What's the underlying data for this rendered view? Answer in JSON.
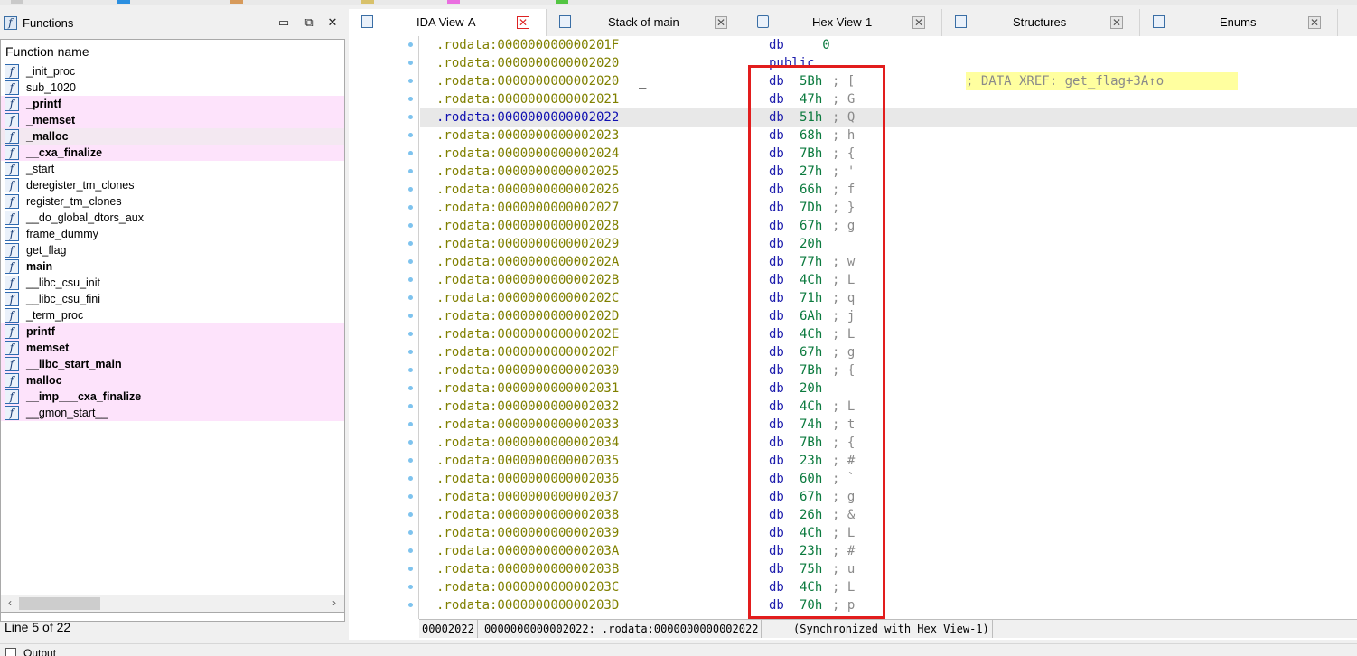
{
  "functions_panel": {
    "title": "Functions",
    "column_header": "Function name",
    "status": "Line 5 of 22",
    "items": [
      {
        "name": "_init_proc",
        "bold": false,
        "pink": false
      },
      {
        "name": "sub_1020",
        "bold": false,
        "pink": false
      },
      {
        "name": "_printf",
        "bold": true,
        "pink": true
      },
      {
        "name": "_memset",
        "bold": true,
        "pink": true
      },
      {
        "name": "_malloc",
        "bold": true,
        "pink": true,
        "selected": true
      },
      {
        "name": "__cxa_finalize",
        "bold": true,
        "pink": true
      },
      {
        "name": "_start",
        "bold": false,
        "pink": false
      },
      {
        "name": "deregister_tm_clones",
        "bold": false,
        "pink": false
      },
      {
        "name": "register_tm_clones",
        "bold": false,
        "pink": false
      },
      {
        "name": "__do_global_dtors_aux",
        "bold": false,
        "pink": false
      },
      {
        "name": "frame_dummy",
        "bold": false,
        "pink": false
      },
      {
        "name": "get_flag",
        "bold": false,
        "pink": false
      },
      {
        "name": "main",
        "bold": true,
        "pink": false
      },
      {
        "name": "__libc_csu_init",
        "bold": false,
        "pink": false
      },
      {
        "name": "__libc_csu_fini",
        "bold": false,
        "pink": false
      },
      {
        "name": "_term_proc",
        "bold": false,
        "pink": false
      },
      {
        "name": "printf",
        "bold": true,
        "pink": true
      },
      {
        "name": "memset",
        "bold": true,
        "pink": true
      },
      {
        "name": "__libc_start_main",
        "bold": true,
        "pink": true
      },
      {
        "name": "malloc",
        "bold": true,
        "pink": true
      },
      {
        "name": "__imp___cxa_finalize",
        "bold": true,
        "pink": true
      },
      {
        "name": "__gmon_start__",
        "bold": false,
        "pink": true
      }
    ]
  },
  "tabs": [
    {
      "label": "IDA View-A",
      "active": true
    },
    {
      "label": "Stack of main",
      "active": false
    },
    {
      "label": "Hex View-1",
      "active": false
    },
    {
      "label": "Structures",
      "active": false
    },
    {
      "label": "Enums",
      "active": false
    }
  ],
  "disasm": {
    "lines": [
      {
        "addr": ".rodata:000000000000201F",
        "label": "",
        "mnem": "db",
        "val": "   0",
        "cmt": ""
      },
      {
        "addr": ".rodata:0000000000002020",
        "label": "",
        "mnem": "public _",
        "val": "",
        "cmt": ""
      },
      {
        "addr": ".rodata:0000000000002020",
        "label": "_",
        "mnem": "db",
        "val": "5Bh",
        "cmt": "; [",
        "xref": "; DATA XREF: get_flag+3A↑o"
      },
      {
        "addr": ".rodata:0000000000002021",
        "label": "",
        "mnem": "db",
        "val": "47h",
        "cmt": "; G"
      },
      {
        "addr": ".rodata:0000000000002022",
        "label": "",
        "mnem": "db",
        "val": "51h",
        "cmt": "; Q",
        "selected": true
      },
      {
        "addr": ".rodata:0000000000002023",
        "label": "",
        "mnem": "db",
        "val": "68h",
        "cmt": "; h"
      },
      {
        "addr": ".rodata:0000000000002024",
        "label": "",
        "mnem": "db",
        "val": "7Bh",
        "cmt": "; {"
      },
      {
        "addr": ".rodata:0000000000002025",
        "label": "",
        "mnem": "db",
        "val": "27h",
        "cmt": "; '"
      },
      {
        "addr": ".rodata:0000000000002026",
        "label": "",
        "mnem": "db",
        "val": "66h",
        "cmt": "; f"
      },
      {
        "addr": ".rodata:0000000000002027",
        "label": "",
        "mnem": "db",
        "val": "7Dh",
        "cmt": "; }"
      },
      {
        "addr": ".rodata:0000000000002028",
        "label": "",
        "mnem": "db",
        "val": "67h",
        "cmt": "; g"
      },
      {
        "addr": ".rodata:0000000000002029",
        "label": "",
        "mnem": "db",
        "val": "20h",
        "cmt": ""
      },
      {
        "addr": ".rodata:000000000000202A",
        "label": "",
        "mnem": "db",
        "val": "77h",
        "cmt": "; w"
      },
      {
        "addr": ".rodata:000000000000202B",
        "label": "",
        "mnem": "db",
        "val": "4Ch",
        "cmt": "; L"
      },
      {
        "addr": ".rodata:000000000000202C",
        "label": "",
        "mnem": "db",
        "val": "71h",
        "cmt": "; q"
      },
      {
        "addr": ".rodata:000000000000202D",
        "label": "",
        "mnem": "db",
        "val": "6Ah",
        "cmt": "; j"
      },
      {
        "addr": ".rodata:000000000000202E",
        "label": "",
        "mnem": "db",
        "val": "4Ch",
        "cmt": "; L"
      },
      {
        "addr": ".rodata:000000000000202F",
        "label": "",
        "mnem": "db",
        "val": "67h",
        "cmt": "; g"
      },
      {
        "addr": ".rodata:0000000000002030",
        "label": "",
        "mnem": "db",
        "val": "7Bh",
        "cmt": "; {"
      },
      {
        "addr": ".rodata:0000000000002031",
        "label": "",
        "mnem": "db",
        "val": "20h",
        "cmt": ""
      },
      {
        "addr": ".rodata:0000000000002032",
        "label": "",
        "mnem": "db",
        "val": "4Ch",
        "cmt": "; L"
      },
      {
        "addr": ".rodata:0000000000002033",
        "label": "",
        "mnem": "db",
        "val": "74h",
        "cmt": "; t"
      },
      {
        "addr": ".rodata:0000000000002034",
        "label": "",
        "mnem": "db",
        "val": "7Bh",
        "cmt": "; {"
      },
      {
        "addr": ".rodata:0000000000002035",
        "label": "",
        "mnem": "db",
        "val": "23h",
        "cmt": "; #"
      },
      {
        "addr": ".rodata:0000000000002036",
        "label": "",
        "mnem": "db",
        "val": "60h",
        "cmt": "; `"
      },
      {
        "addr": ".rodata:0000000000002037",
        "label": "",
        "mnem": "db",
        "val": "67h",
        "cmt": "; g"
      },
      {
        "addr": ".rodata:0000000000002038",
        "label": "",
        "mnem": "db",
        "val": "26h",
        "cmt": "; &"
      },
      {
        "addr": ".rodata:0000000000002039",
        "label": "",
        "mnem": "db",
        "val": "4Ch",
        "cmt": "; L"
      },
      {
        "addr": ".rodata:000000000000203A",
        "label": "",
        "mnem": "db",
        "val": "23h",
        "cmt": "; #"
      },
      {
        "addr": ".rodata:000000000000203B",
        "label": "",
        "mnem": "db",
        "val": "75h",
        "cmt": "; u"
      },
      {
        "addr": ".rodata:000000000000203C",
        "label": "",
        "mnem": "db",
        "val": "4Ch",
        "cmt": "; L"
      },
      {
        "addr": ".rodata:000000000000203D",
        "label": "",
        "mnem": "db",
        "val": "70h",
        "cmt": "; p"
      }
    ],
    "status": {
      "offset": "00002022",
      "location": "0000000000002022: .rodata:0000000000002022",
      "sync": "(Synchronized with Hex View-1)"
    }
  },
  "output": {
    "label": "Output"
  },
  "colors": {
    "address": "#808000",
    "mnemonic": "#1d1dad",
    "value": "#0b7a3e",
    "comment": "#8a8a8a",
    "import_highlight": "#fde3fb",
    "xref_highlight": "#ffff9f",
    "annotation_box": "#e21d1d"
  }
}
